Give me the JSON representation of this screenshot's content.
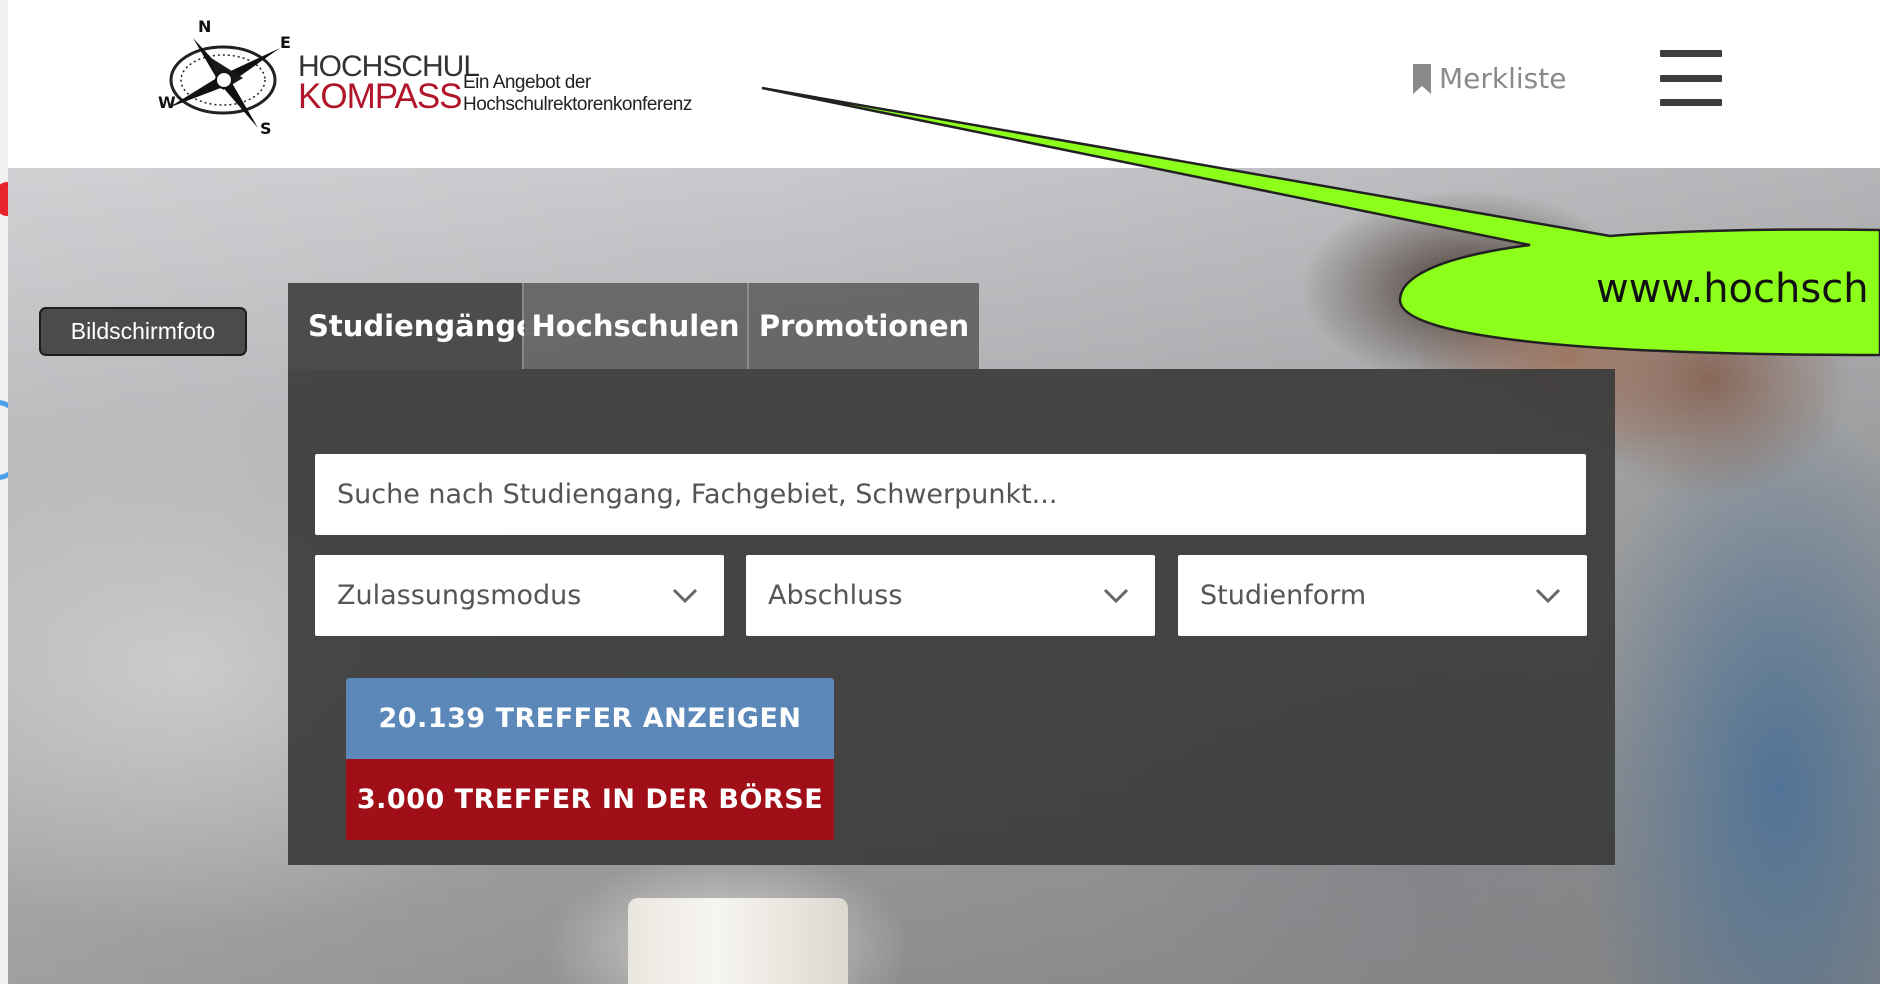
{
  "header": {
    "logo": {
      "line1": "HOCHSCHUL",
      "line2": "KOMPASS",
      "compass_letters": [
        "N",
        "E",
        "S",
        "W"
      ]
    },
    "tagline_line1": "Ein Angebot der",
    "tagline_line2": "Hochschulrektorenkonferenz",
    "merkliste_label": "Merkliste",
    "menu_icon": "hamburger-icon"
  },
  "search": {
    "tabs": [
      {
        "label": "Studiengänge",
        "active": true
      },
      {
        "label": "Hochschulen",
        "active": false
      },
      {
        "label": "Promotionen",
        "active": false
      }
    ],
    "input_placeholder": "Suche nach Studiengang, Fachgebiet, Schwerpunkt...",
    "selects": [
      {
        "label": "Zulassungsmodus"
      },
      {
        "label": "Abschluss"
      },
      {
        "label": "Studienform"
      }
    ],
    "primary_button": "20.139 TREFFER ANZEIGEN",
    "secondary_button": "3.000 TREFFER IN DER BÖRSE"
  },
  "tooltip": {
    "label": "Bildschirmfoto"
  },
  "callout": {
    "text": "www.hochsch"
  },
  "colors": {
    "accent_blue": "#5b88b8",
    "accent_red": "#a00f17",
    "logo_red": "#b0152a",
    "callout_green": "#8cff1a"
  }
}
